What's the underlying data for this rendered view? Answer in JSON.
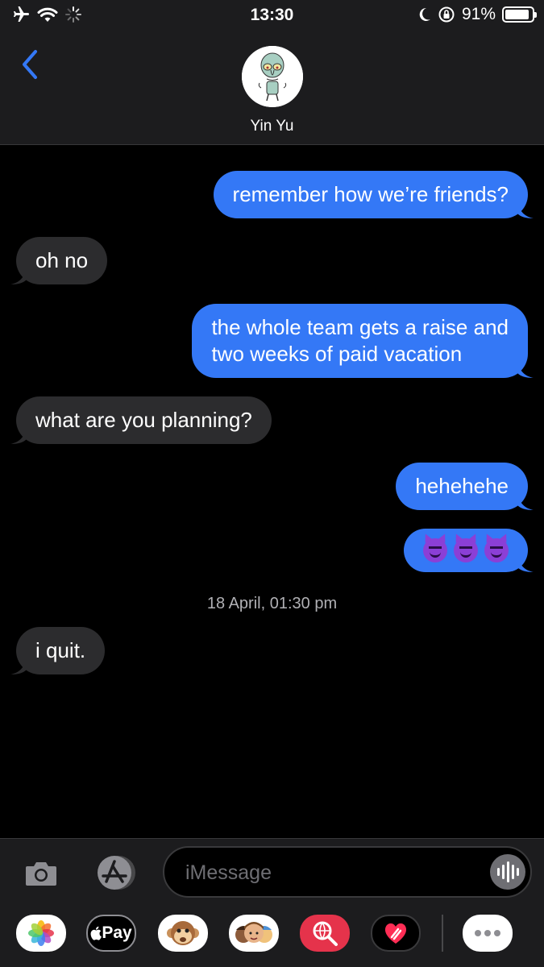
{
  "status_bar": {
    "time": "13:30",
    "battery_percent": "91%",
    "battery_level": 0.91,
    "icons": [
      "airplane-icon",
      "wifi-icon",
      "loading-spinner-icon",
      "moon-icon",
      "orientation-lock-icon",
      "battery-icon"
    ]
  },
  "header": {
    "back_icon": "chevron-left-icon",
    "contact_name": "Yin Yu"
  },
  "messages": [
    {
      "direction": "outgoing",
      "text": "remember how we’re friends?"
    },
    {
      "direction": "incoming",
      "text": "oh no"
    },
    {
      "direction": "outgoing",
      "lines": [
        "the whole team gets a raise and",
        "two weeks of paid vacation"
      ]
    },
    {
      "direction": "incoming",
      "text": "what are you planning?"
    },
    {
      "direction": "outgoing",
      "text": "hehehehe"
    },
    {
      "direction": "outgoing",
      "emoji": [
        "smiling-face-with-horns",
        "smiling-face-with-horns",
        "smiling-face-with-horns"
      ]
    },
    {
      "direction": "incoming",
      "text": "i quit."
    }
  ],
  "timestamp": "18 April, 01:30 pm",
  "composer": {
    "placeholder": "iMessage",
    "camera_icon": "camera-icon",
    "apps_icon": "app-store-icon",
    "audio_icon": "audio-waveform-icon"
  },
  "app_tray": {
    "items": [
      {
        "name": "photos-app",
        "icon": "photos-icon"
      },
      {
        "name": "apple-pay-app",
        "label": "Pay"
      },
      {
        "name": "animoji-app",
        "icon": "monkey-icon"
      },
      {
        "name": "memoji-app",
        "icon": "memoji-icon"
      },
      {
        "name": "image-search-app",
        "icon": "globe-search-icon"
      },
      {
        "name": "digital-touch-app",
        "icon": "heart-icon"
      },
      {
        "name": "more-apps",
        "icon": "ellipsis-icon"
      }
    ]
  },
  "colors": {
    "outgoing_bubble": "#3478f6",
    "incoming_bubble": "#2c2c2e",
    "background": "#000000",
    "bar_background": "#1c1c1e",
    "accent": "#3478f6"
  }
}
